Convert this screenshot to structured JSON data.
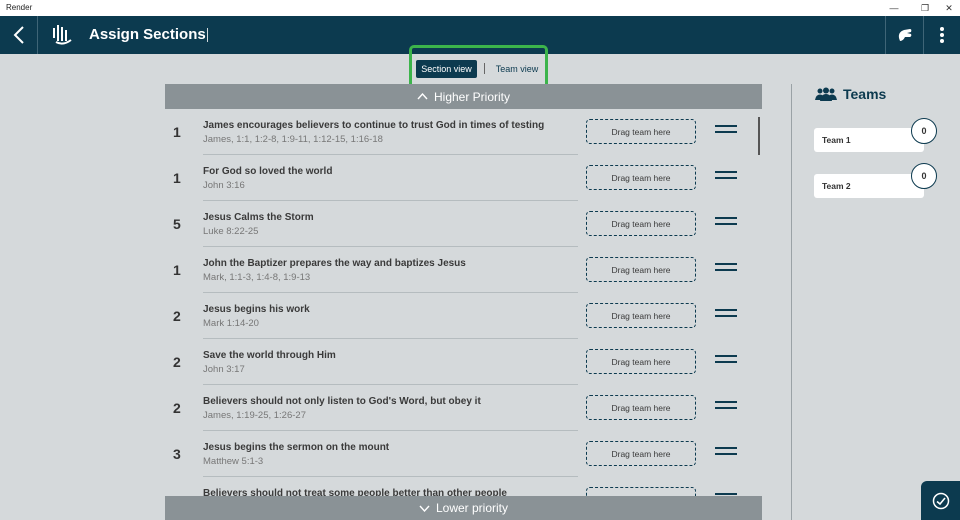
{
  "window": {
    "app_name": "Render",
    "minimize": "—",
    "restore": "❐",
    "close": "✕"
  },
  "header": {
    "title": "Assign Sections",
    "icons": {
      "back": "back-arrow-icon",
      "logo": "render-logo-icon",
      "right1": "hand-icon",
      "right2": "more-vertical-icon"
    }
  },
  "view_toggle": {
    "section_view": "Section view",
    "team_view": "Team view",
    "selected": "Section view"
  },
  "priority": {
    "higher": "Higher Priority",
    "lower": "Lower priority"
  },
  "drop_label": "Drag team here",
  "sections": [
    {
      "num": "1",
      "title": "James encourages believers to continue to trust God in times of testing",
      "ref": "James, 1:1, 1:2-8, 1:9-11, 1:12-15, 1:16-18"
    },
    {
      "num": "1",
      "title": "For God so loved the world",
      "ref": "John 3:16"
    },
    {
      "num": "5",
      "title": "Jesus Calms the Storm",
      "ref": "Luke 8:22-25"
    },
    {
      "num": "1",
      "title": "John the Baptizer prepares the way and baptizes Jesus",
      "ref": "Mark, 1:1-3, 1:4-8, 1:9-13"
    },
    {
      "num": "2",
      "title": "Jesus begins his work",
      "ref": "Mark 1:14-20"
    },
    {
      "num": "2",
      "title": "Save the world through Him",
      "ref": "John 3:17"
    },
    {
      "num": "2",
      "title": "Believers should not only listen to God's Word, but obey it",
      "ref": "James, 1:19-25, 1:26-27"
    },
    {
      "num": "3",
      "title": "Jesus begins the sermon on the mount",
      "ref": "Matthew 5:1-3"
    },
    {
      "num": "",
      "title": "Believers should not treat some people better than other people",
      "ref": ""
    }
  ],
  "teams_panel": {
    "title": "Teams",
    "teams": [
      {
        "name": "Team 1",
        "count": "0"
      },
      {
        "name": "Team 2",
        "count": "0"
      }
    ]
  },
  "colors": {
    "primary": "#0c3a4f",
    "highlight": "#3cb44b",
    "priority_bar": "#8a9296",
    "background": "#d5d9db"
  }
}
